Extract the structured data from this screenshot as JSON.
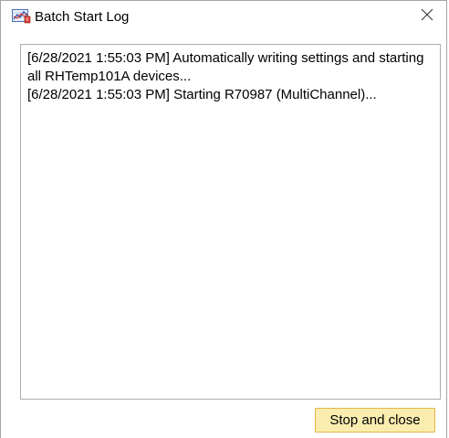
{
  "window": {
    "title": "Batch Start Log",
    "icon": "chart-log-icon",
    "close_icon": "close-icon"
  },
  "log": {
    "lines": [
      "[6/28/2021 1:55:03 PM] Automatically writing settings and starting all RHTemp101A devices...",
      "[6/28/2021 1:55:03 PM] Starting R70987 (MultiChannel)..."
    ]
  },
  "actions": {
    "stop_label": "Stop and close"
  },
  "colors": {
    "button_bg": "#fbedb0",
    "button_border": "#e5b64a",
    "window_border": "#a6a6a6"
  }
}
